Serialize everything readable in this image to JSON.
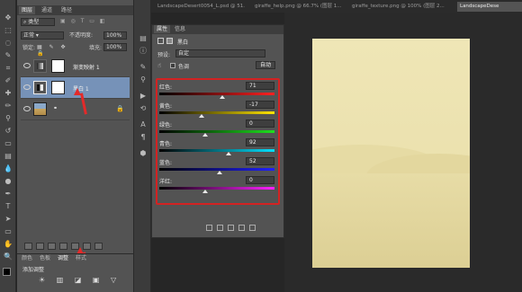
{
  "document_tabs": [
    {
      "label": "LandscapeDesert0054_L.psd @ 51...",
      "active": false
    },
    {
      "label": "giraffe_help.png @ 66.7% (图层 1...",
      "active": false
    },
    {
      "label": "giraffe_texture.png @ 100% (图层 2...",
      "active": false
    },
    {
      "label": "LandscapeDese",
      "active": true
    }
  ],
  "layers_panel": {
    "tabs": [
      "图层",
      "通道",
      "路径"
    ],
    "filter_label": "类型",
    "blend_mode": "正常",
    "opacity_label": "不透明度:",
    "opacity_value": "100%",
    "lock_label": "锁定:",
    "fill_label": "填充:",
    "fill_value": "100%",
    "layers": [
      {
        "name": "渐变映射 1",
        "selected": false
      },
      {
        "name": "黑白 1",
        "selected": true
      },
      {
        "name": "",
        "selected": false
      }
    ]
  },
  "properties_panel": {
    "tabs": [
      "属性",
      "信息"
    ],
    "title": "黑白",
    "preset_label": "预设:",
    "preset_value": "自定",
    "tint_label": "色调",
    "auto_button": "自动",
    "sliders": [
      {
        "label": "红色:",
        "value": "71",
        "position": 0.55,
        "gradient": "red"
      },
      {
        "label": "黄色:",
        "value": "-17",
        "position": 0.37,
        "gradient": "yellow"
      },
      {
        "label": "绿色:",
        "value": "0",
        "position": 0.4,
        "gradient": "green"
      },
      {
        "label": "青色:",
        "value": "92",
        "position": 0.6,
        "gradient": "cyan"
      },
      {
        "label": "蓝色:",
        "value": "52",
        "position": 0.52,
        "gradient": "blue"
      },
      {
        "label": "洋红:",
        "value": "0",
        "position": 0.4,
        "gradient": "magenta"
      }
    ]
  },
  "adjustments_panel": {
    "tabs": [
      "颜色",
      "色板",
      "调整",
      "样式"
    ],
    "active_tab": "调整",
    "title": "添加调整"
  },
  "colors": {
    "highlight_box": "#d32222",
    "selected_layer": "#7692b8",
    "canvas_sand": "#ebe1ae"
  }
}
